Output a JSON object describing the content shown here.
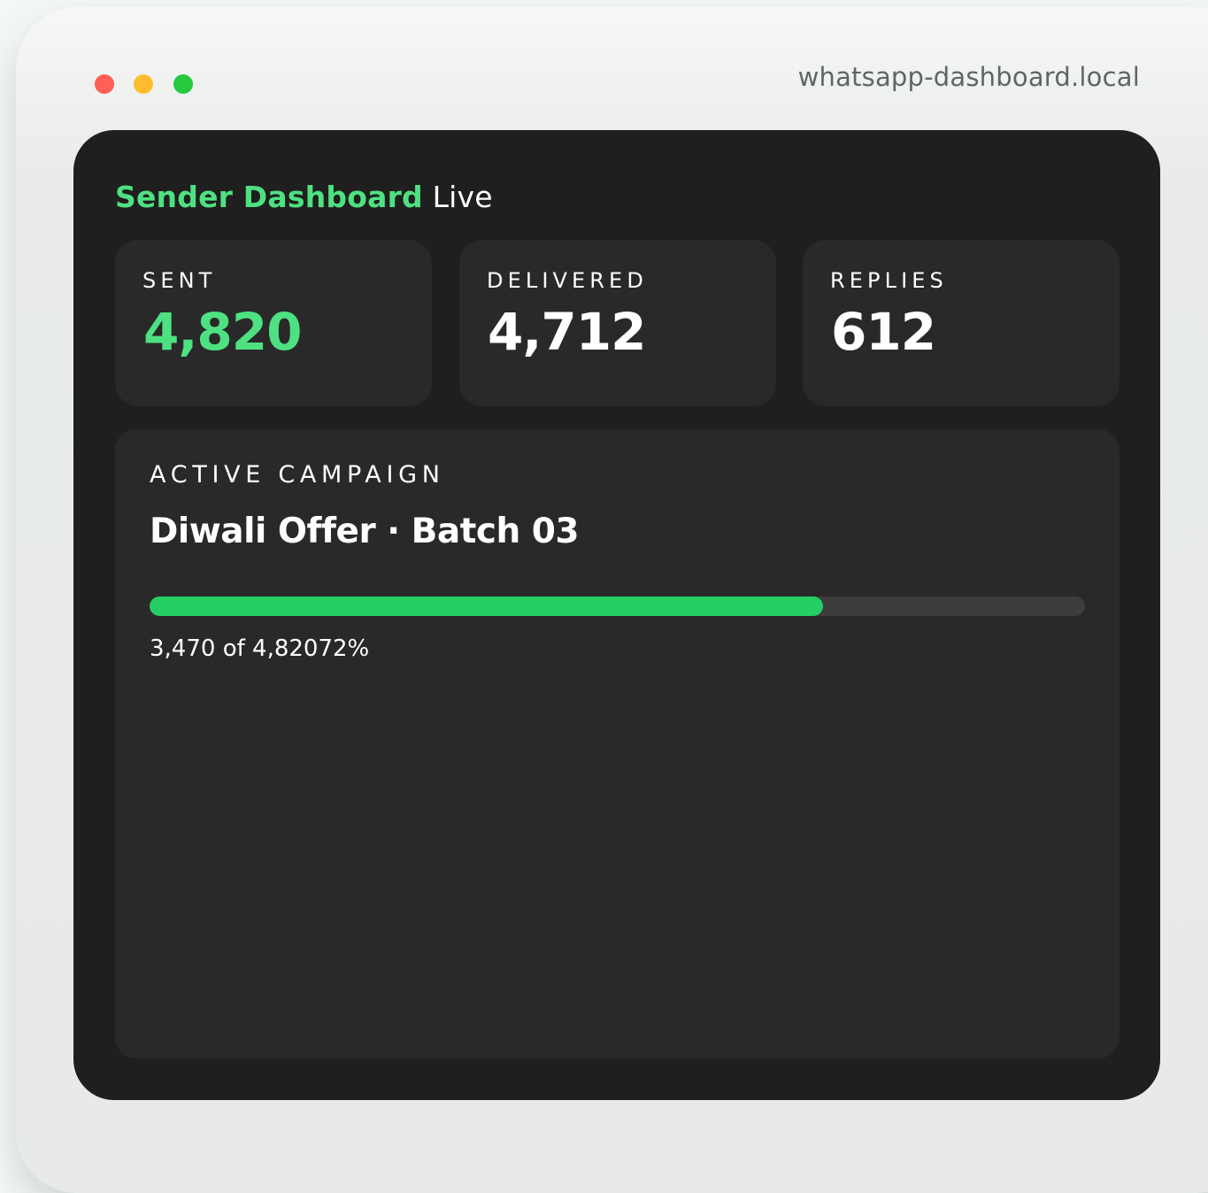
{
  "window": {
    "url": "whatsapp-dashboard.local"
  },
  "header": {
    "title": "Sender Dashboard",
    "status": "Live"
  },
  "stats": [
    {
      "label": "SENT",
      "value": "4,820"
    },
    {
      "label": "DELIVERED",
      "value": "4,712"
    },
    {
      "label": "REPLIES",
      "value": "612"
    }
  ],
  "campaign": {
    "section_label": "ACTIVE CAMPAIGN",
    "name": "Diwali Offer · Batch 03",
    "progress": {
      "sent": "3,470",
      "separator": " of ",
      "total": "4,820",
      "percent_label": "72%",
      "fraction": 0.72
    }
  },
  "colors": {
    "accent": "#4ee181",
    "progress": "#25ce63",
    "panel": "#1f1f1f",
    "card": "#292929"
  }
}
